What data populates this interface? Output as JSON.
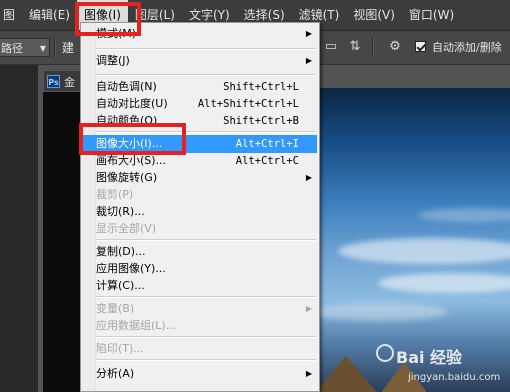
{
  "menubar": {
    "items": [
      {
        "label": "图"
      },
      {
        "label": "编辑(E)"
      },
      {
        "label": "图像(I)"
      },
      {
        "label": "图层(L)"
      },
      {
        "label": "文字(Y)"
      },
      {
        "label": "选择(S)"
      },
      {
        "label": "滤镜(T)"
      },
      {
        "label": "视图(V)"
      },
      {
        "label": "窗口(W)"
      }
    ],
    "active_index": 2
  },
  "toolbar": {
    "path_field": "路径",
    "partial_text": "建",
    "auto_add_delete": "自动添加/删除"
  },
  "document_tab": {
    "badge": "Ps",
    "title_partial": "金"
  },
  "image_menu": {
    "items": [
      {
        "label": "模式(M)",
        "shortcut": "",
        "submenu": true,
        "disabled": false
      },
      {
        "label": "调整(J)",
        "shortcut": "",
        "submenu": true,
        "disabled": false
      },
      {
        "label": "自动色调(N)",
        "shortcut": "Shift+Ctrl+L",
        "submenu": false,
        "disabled": false
      },
      {
        "label": "自动对比度(U)",
        "shortcut": "Alt+Shift+Ctrl+L",
        "submenu": false,
        "disabled": false
      },
      {
        "label": "自动颜色(O)",
        "shortcut": "Shift+Ctrl+B",
        "submenu": false,
        "disabled": false
      },
      {
        "label": "图像大小(I)...",
        "shortcut": "Alt+Ctrl+I",
        "submenu": false,
        "disabled": false,
        "highlighted": true
      },
      {
        "label": "画布大小(S)...",
        "shortcut": "Alt+Ctrl+C",
        "submenu": false,
        "disabled": false
      },
      {
        "label": "图像旋转(G)",
        "shortcut": "",
        "submenu": true,
        "disabled": false
      },
      {
        "label": "裁剪(P)",
        "shortcut": "",
        "submenu": false,
        "disabled": true
      },
      {
        "label": "裁切(R)...",
        "shortcut": "",
        "submenu": false,
        "disabled": false
      },
      {
        "label": "显示全部(V)",
        "shortcut": "",
        "submenu": false,
        "disabled": true
      },
      {
        "label": "复制(D)...",
        "shortcut": "",
        "submenu": false,
        "disabled": false
      },
      {
        "label": "应用图像(Y)...",
        "shortcut": "",
        "submenu": false,
        "disabled": false
      },
      {
        "label": "计算(C)...",
        "shortcut": "",
        "submenu": false,
        "disabled": false
      },
      {
        "label": "变量(B)",
        "shortcut": "",
        "submenu": true,
        "disabled": true
      },
      {
        "label": "应用数据组(L)...",
        "shortcut": "",
        "submenu": false,
        "disabled": true
      },
      {
        "label": "陷印(T)...",
        "shortcut": "",
        "submenu": false,
        "disabled": true
      },
      {
        "label": "分析(A)",
        "shortcut": "",
        "submenu": true,
        "disabled": false
      }
    ]
  },
  "watermark": {
    "brand": "Bai 经验",
    "url": "jingyan.baidu.com"
  },
  "colors": {
    "highlight": "#3399ff",
    "annotation_red": "#e32221",
    "menu_bg": "#f0f0f0"
  }
}
